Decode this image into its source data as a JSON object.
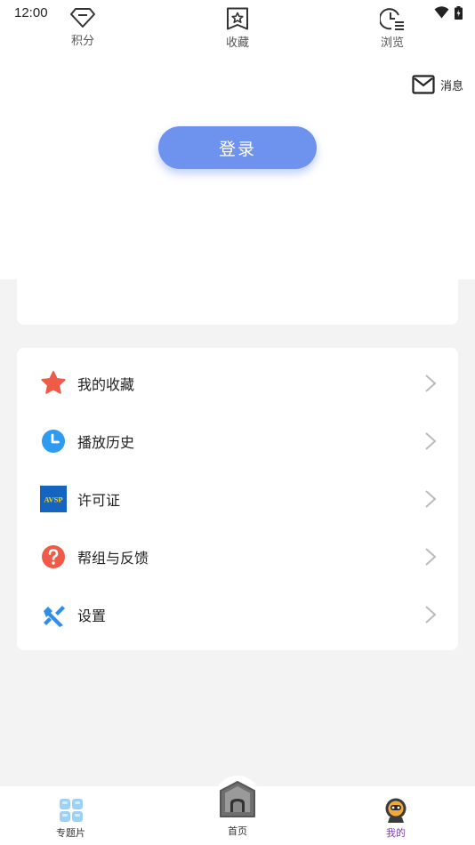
{
  "status_bar": {
    "time": "12:00"
  },
  "header": {
    "message_label": "消息",
    "login_label": "登录"
  },
  "stats": [
    {
      "label": "积分",
      "icon": "diamond-icon"
    },
    {
      "label": "收藏",
      "icon": "star-bookmark-icon"
    },
    {
      "label": "浏览",
      "icon": "clock-list-icon"
    }
  ],
  "menu": {
    "items": [
      {
        "label": "我的收藏",
        "icon": "star-icon"
      },
      {
        "label": "播放历史",
        "icon": "clock-icon"
      },
      {
        "label": "许可证",
        "icon": "avsp-logo-icon",
        "logo_text": "AVSP"
      },
      {
        "label": "帮组与反馈",
        "icon": "help-icon"
      },
      {
        "label": "设置",
        "icon": "wrench-icon"
      }
    ]
  },
  "bottom_nav": {
    "items": [
      {
        "label": "专题片",
        "icon": "grid-icon"
      },
      {
        "label": "首页",
        "icon": "home-icon"
      },
      {
        "label": "我的",
        "icon": "astronaut-icon",
        "active": true
      }
    ]
  },
  "colors": {
    "accent": "#6e93ef",
    "active_nav": "#7b3fb8",
    "star": "#ef5b48",
    "clock": "#2e9bf0",
    "help": "#ef5b48",
    "wrench": "#2f8ee8"
  }
}
